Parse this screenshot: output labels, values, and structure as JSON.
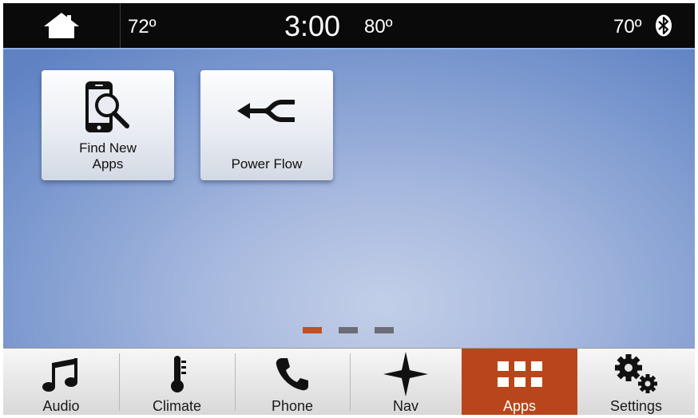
{
  "status_bar": {
    "temp_left": "72º",
    "clock": "3:00",
    "temp_outside": "80º",
    "temp_right": "70º",
    "home_icon": "home-icon",
    "bluetooth_icon": "bluetooth-icon"
  },
  "apps": [
    {
      "label": "Find New\nApps",
      "icon": "phone-search-icon"
    },
    {
      "label": "Power Flow",
      "icon": "power-flow-icon"
    }
  ],
  "pagination": {
    "pages": 3,
    "active_index": 0,
    "active_color": "#c0501f",
    "inactive_color": "#6b6e76"
  },
  "nav": {
    "active_color": "#b8461a",
    "items": [
      {
        "label": "Audio",
        "icon": "music-note-icon"
      },
      {
        "label": "Climate",
        "icon": "thermometer-icon"
      },
      {
        "label": "Phone",
        "icon": "phone-icon"
      },
      {
        "label": "Nav",
        "icon": "compass-star-icon"
      },
      {
        "label": "Apps",
        "icon": "grid-icon",
        "active": true
      },
      {
        "label": "Settings",
        "icon": "gears-icon"
      }
    ]
  }
}
